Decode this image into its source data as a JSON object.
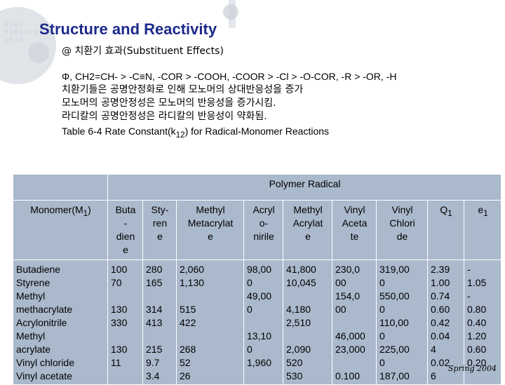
{
  "title": "Structure and Reactivity",
  "subtitle": "@ 치환기 효과(Substituent Effects)",
  "lines": [
    "Φ, CH2=CH- > -C≡N, -COR > -COOH, -COOR > -Cl > -O-COR, -R > -OR, -H",
    "치환기들은 공명안정화로 인해 모노머의 상대반응성을 증가",
    "모노머의 공명안정성은 모노머의 반응성을 증가시킴.",
    "라디칼의 공명안정성은 라디칼의 반응성이 약화됨."
  ],
  "caption_pre": "Table 6-4 Rate Constant(k",
  "caption_sub": "12",
  "caption_post": ") for Radical-Monomer Reactions",
  "table": {
    "group_header": "Polymer Radical",
    "monomer_header": "Monomer(M",
    "monomer_header_sub": "1",
    "monomer_header_post": ")",
    "columns": [
      "Buta\n-\ndien\ne",
      "Sty-\nren\ne",
      "Methyl\nMetacrylat\ne",
      "Acryl\no-\nnirile",
      "Methyl\nAcrylat\ne",
      "Vinyl\nAceta\nte",
      "Vinyl\nChlori\nde"
    ],
    "q_header": "Q",
    "q_header_sub": "1",
    "e_header": "e",
    "e_header_sub": "1",
    "monomers": [
      "Butadiene",
      "Styrene",
      "Methyl",
      "  methacrylate",
      "Acrylonitrile",
      "Methyl",
      "  acrylate",
      "Vinyl chloride",
      "Vinyl acetate"
    ],
    "col_values": [
      [
        "100",
        "70",
        "",
        "130",
        "330",
        "",
        "130",
        "11",
        ""
      ],
      [
        "280",
        "165",
        "",
        "314",
        "413",
        "",
        "215",
        "9.7",
        "3.4"
      ],
      [
        "2,060",
        "1,130",
        "",
        "515",
        "422",
        "",
        "268",
        "52",
        "26"
      ],
      [
        "98,00",
        "0",
        "49,00",
        "0",
        "",
        "13,10",
        "0",
        "1,960",
        ""
      ],
      [
        "41,800",
        "10,045",
        "",
        "4,180",
        "2,510",
        "",
        "2,090",
        "520",
        "530"
      ],
      [
        "230,0",
        "00",
        "154,0",
        "00",
        "",
        "46,000",
        "23,000",
        "",
        "0.100"
      ],
      [
        "319,00",
        "0",
        "550,00",
        "0",
        "110,00",
        "0",
        "225,00",
        "0",
        "187,00"
      ]
    ],
    "q_values": [
      "2.39",
      "1.00",
      "0.74",
      "0.60",
      "0.42",
      "0.04",
      "4",
      "0.02",
      "6"
    ],
    "e_values": [
      "-",
      "1.05",
      "-",
      "0.80",
      "0.40",
      "1.20",
      "0.60",
      "0.20",
      ""
    ]
  },
  "footer": "Spring 2004"
}
